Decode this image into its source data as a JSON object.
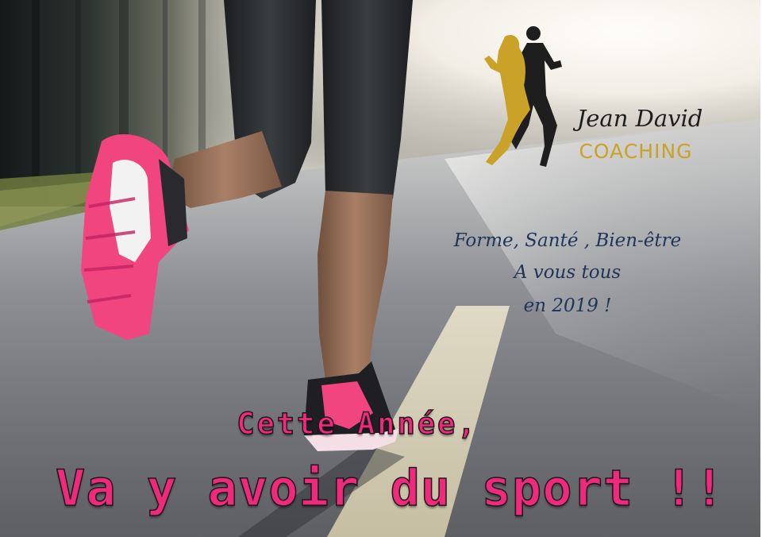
{
  "brand": {
    "name": "Jean David",
    "subtitle": "COACHING"
  },
  "tagline": {
    "line1": "Forme, Santé , Bien-être",
    "line2": "A vous tous",
    "line3": "en 2019 !"
  },
  "slogan": {
    "line1": "Cette Année,",
    "line2": "Va y avoir du sport !!"
  },
  "colors": {
    "brand_gold": "#c9a227",
    "brand_dark": "#1e1e1e",
    "tagline_navy": "#1f3557",
    "slogan_pink": "#ee2a7b",
    "shoe_pink": "#f0457f",
    "road_gray": "#7e8085"
  },
  "icons": {
    "logo": "running-couple-silhouette"
  }
}
